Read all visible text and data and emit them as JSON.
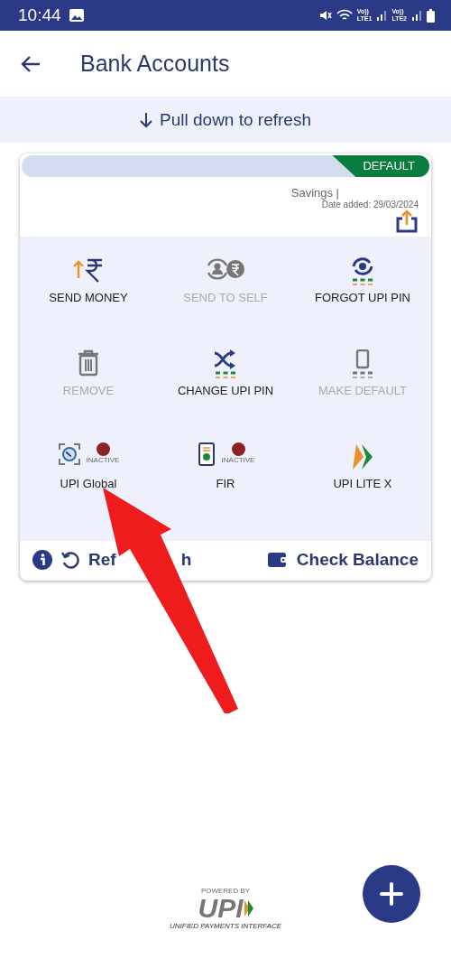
{
  "status_bar": {
    "time": "10:44",
    "sim_1": "Vo))\nLTE1",
    "sim_2": "Vo))\nLTE2"
  },
  "header": {
    "title": "Bank Accounts"
  },
  "refresh_banner": {
    "text": "Pull down to refresh"
  },
  "account_card": {
    "badge": "DEFAULT",
    "account_type": "Savings |",
    "date_added": "Date added: 29/03/2024",
    "actions": [
      {
        "kind": "send",
        "label": "SEND MONEY",
        "disabled": false
      },
      {
        "kind": "self",
        "label": "SEND TO SELF",
        "disabled": true
      },
      {
        "kind": "forgot",
        "label": "FORGOT UPI PIN",
        "disabled": false
      },
      {
        "kind": "remove",
        "label": "REMOVE",
        "disabled": true
      },
      {
        "kind": "change",
        "label": "CHANGE UPI PIN",
        "disabled": false
      },
      {
        "kind": "default",
        "label": "MAKE DEFAULT",
        "disabled": true
      },
      {
        "kind": "global",
        "label": "UPI Global",
        "disabled": false,
        "status": "INACTIVE",
        "color": "#8b2323"
      },
      {
        "kind": "fir",
        "label": "FIR",
        "disabled": false,
        "status": "INACTIVE",
        "color": "#8b2323"
      },
      {
        "kind": "lite",
        "label": "UPI LITE X",
        "disabled": false
      }
    ],
    "footer": {
      "refresh": "Ref",
      "refresh_tail": "h",
      "check_balance": "Check Balance"
    }
  },
  "powered_by": {
    "caption": "POWERED BY",
    "logo": "UPI",
    "tagline": "UNIFIED PAYMENTS INTERFACE"
  }
}
